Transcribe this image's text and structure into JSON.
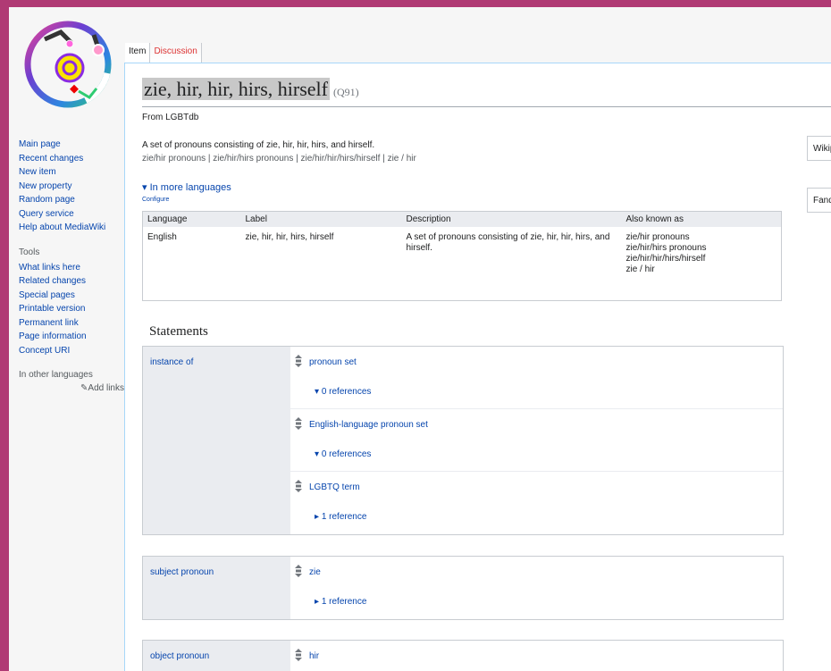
{
  "tabs": [
    {
      "label": "Item"
    },
    {
      "label": "Discussion"
    }
  ],
  "sidebar": {
    "nav": [
      "Main page",
      "Recent changes",
      "New item",
      "New property",
      "Random page",
      "Query service",
      "Help about MediaWiki"
    ],
    "tools_heading": "Tools",
    "tools": [
      "What links here",
      "Related changes",
      "Special pages",
      "Printable version",
      "Permanent link",
      "Page information",
      "Concept URI"
    ],
    "languages_heading": "In other languages",
    "add_links": "Add links"
  },
  "item": {
    "title": "zie, hir, hir, hirs, hirself",
    "qid": "(Q91)",
    "from": "From LGBTdb",
    "description": "A set of pronouns consisting of zie, hir, hir, hirs, and hirself.",
    "aliases": "zie/hir pronouns | zie/hir/hirs pronouns | zie/hir/hir/hirs/hirself | zie / hir"
  },
  "languages": {
    "toggle": "In more languages",
    "configure": "Configure",
    "headers": [
      "Language",
      "Label",
      "Description",
      "Also known as"
    ],
    "rows": [
      {
        "language": "English",
        "label": "zie, hir, hir, hirs, hirself",
        "description": "A set of pronouns consisting of zie, hir, hir, hirs, and hirself.",
        "aliases": [
          "zie/hir pronouns",
          "zie/hir/hirs pronouns",
          "zie/hir/hir/hirs/hirself",
          "zie / hir"
        ]
      }
    ]
  },
  "statements": {
    "heading": "Statements",
    "groups": [
      {
        "property": "instance of",
        "values": [
          {
            "value": "pronoun set",
            "refs": "0 references"
          },
          {
            "value": "English-language pronoun set",
            "refs": "0 references"
          },
          {
            "value": "LGBTQ term",
            "refs": "1 reference"
          }
        ]
      },
      {
        "property": "subject pronoun",
        "values": [
          {
            "value": "zie",
            "refs": "1 reference"
          }
        ]
      },
      {
        "property": "object pronoun",
        "values": [
          {
            "value": "hir",
            "refs": ""
          }
        ]
      }
    ]
  },
  "sitelinks": [
    "Wikipedia",
    "Fandom"
  ],
  "colors": {
    "background": "#b03a74",
    "link": "#0645ad",
    "discussion": "#d33"
  }
}
